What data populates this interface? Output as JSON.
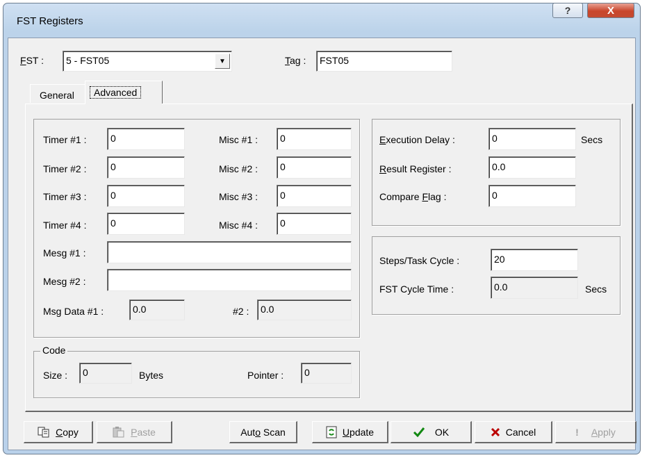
{
  "window": {
    "title": "FST Registers",
    "help_symbol": "?",
    "close_symbol": "X"
  },
  "top": {
    "fst_label_key": "F",
    "fst_label_rest": "ST :",
    "fst_value": "5 - FST05",
    "tag_label_key": "T",
    "tag_label_rest": "ag :",
    "tag_value": "FST05"
  },
  "tabs": [
    {
      "label": "General"
    },
    {
      "label": "Advanced"
    }
  ],
  "timers": [
    {
      "label": "Timer #1 :",
      "value": "0"
    },
    {
      "label": "Timer #2 :",
      "value": "0"
    },
    {
      "label": "Timer #3 :",
      "value": "0"
    },
    {
      "label": "Timer #4 :",
      "value": "0"
    }
  ],
  "misc": [
    {
      "label": "Misc #1 :",
      "value": "0"
    },
    {
      "label": "Misc #2 :",
      "value": "0"
    },
    {
      "label": "Misc #3 :",
      "value": "0"
    },
    {
      "label": "Misc #4 :",
      "value": "0"
    }
  ],
  "mesg": [
    {
      "label": "Mesg #1 :",
      "value": ""
    },
    {
      "label": "Mesg #2 :",
      "value": ""
    }
  ],
  "msg_data": {
    "label1": "Msg Data #1 :",
    "value1": "0.0",
    "label2": "#2 :",
    "value2": "0.0"
  },
  "code": {
    "title": "Code",
    "size_label": "Size :",
    "size_value": "0",
    "size_unit": "Bytes",
    "pointer_label": "Pointer :",
    "pointer_value": "0"
  },
  "execution": {
    "delay_key": "E",
    "delay_rest": "xecution Delay :",
    "delay_value": "0",
    "delay_unit": "Secs",
    "result_key": "R",
    "result_rest": "esult Register :",
    "result_value": "0.0",
    "compare_pre": "Compare ",
    "compare_key": "F",
    "compare_rest": "lag :",
    "compare_value": "0"
  },
  "cycle": {
    "steps_label": "Steps/Task Cycle :",
    "steps_value": "20",
    "time_label": "FST Cycle Time :",
    "time_value": "0.0",
    "time_unit": "Secs"
  },
  "buttons": {
    "copy_key": "C",
    "copy_rest": "opy",
    "paste_key": "P",
    "paste_rest": "aste",
    "autoscan_pre": "Aut",
    "autoscan_key": "o",
    "autoscan_rest": " Scan",
    "update_key": "U",
    "update_rest": "pdate",
    "ok": "OK",
    "cancel": "Cancel",
    "apply_key": "A",
    "apply_rest": "pply"
  }
}
